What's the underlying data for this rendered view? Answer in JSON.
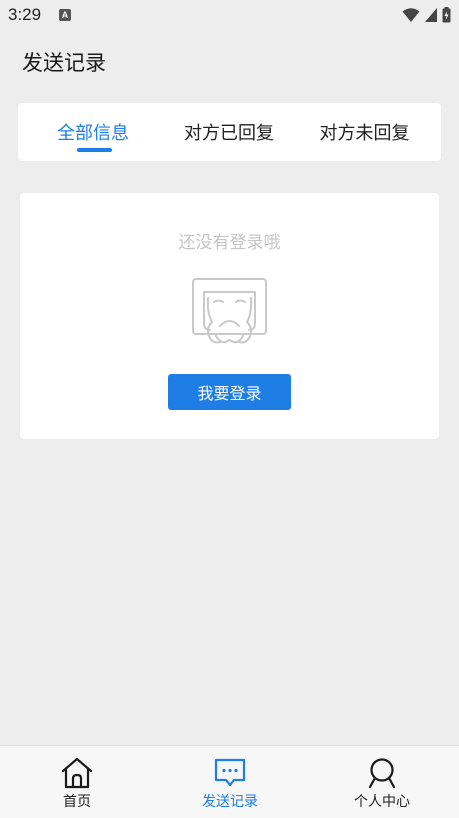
{
  "status_bar": {
    "time": "3:29",
    "notification_icon": "A"
  },
  "header": {
    "title": "发送记录"
  },
  "tabs": [
    {
      "label": "全部信息",
      "active": true
    },
    {
      "label": "对方已回复",
      "active": false
    },
    {
      "label": "对方未回复",
      "active": false
    }
  ],
  "empty_state": {
    "message": "还没有登录哦",
    "illustration": "crying-face-icon",
    "button_label": "我要登录"
  },
  "bottom_nav": [
    {
      "label": "首页",
      "icon": "home-icon",
      "active": false
    },
    {
      "label": "发送记录",
      "icon": "message-icon",
      "active": true
    },
    {
      "label": "个人中心",
      "icon": "user-icon",
      "active": false
    }
  ],
  "colors": {
    "accent": "#1e7ee6",
    "background": "#ededed",
    "card": "#ffffff",
    "muted_text": "#c6c6c6"
  }
}
